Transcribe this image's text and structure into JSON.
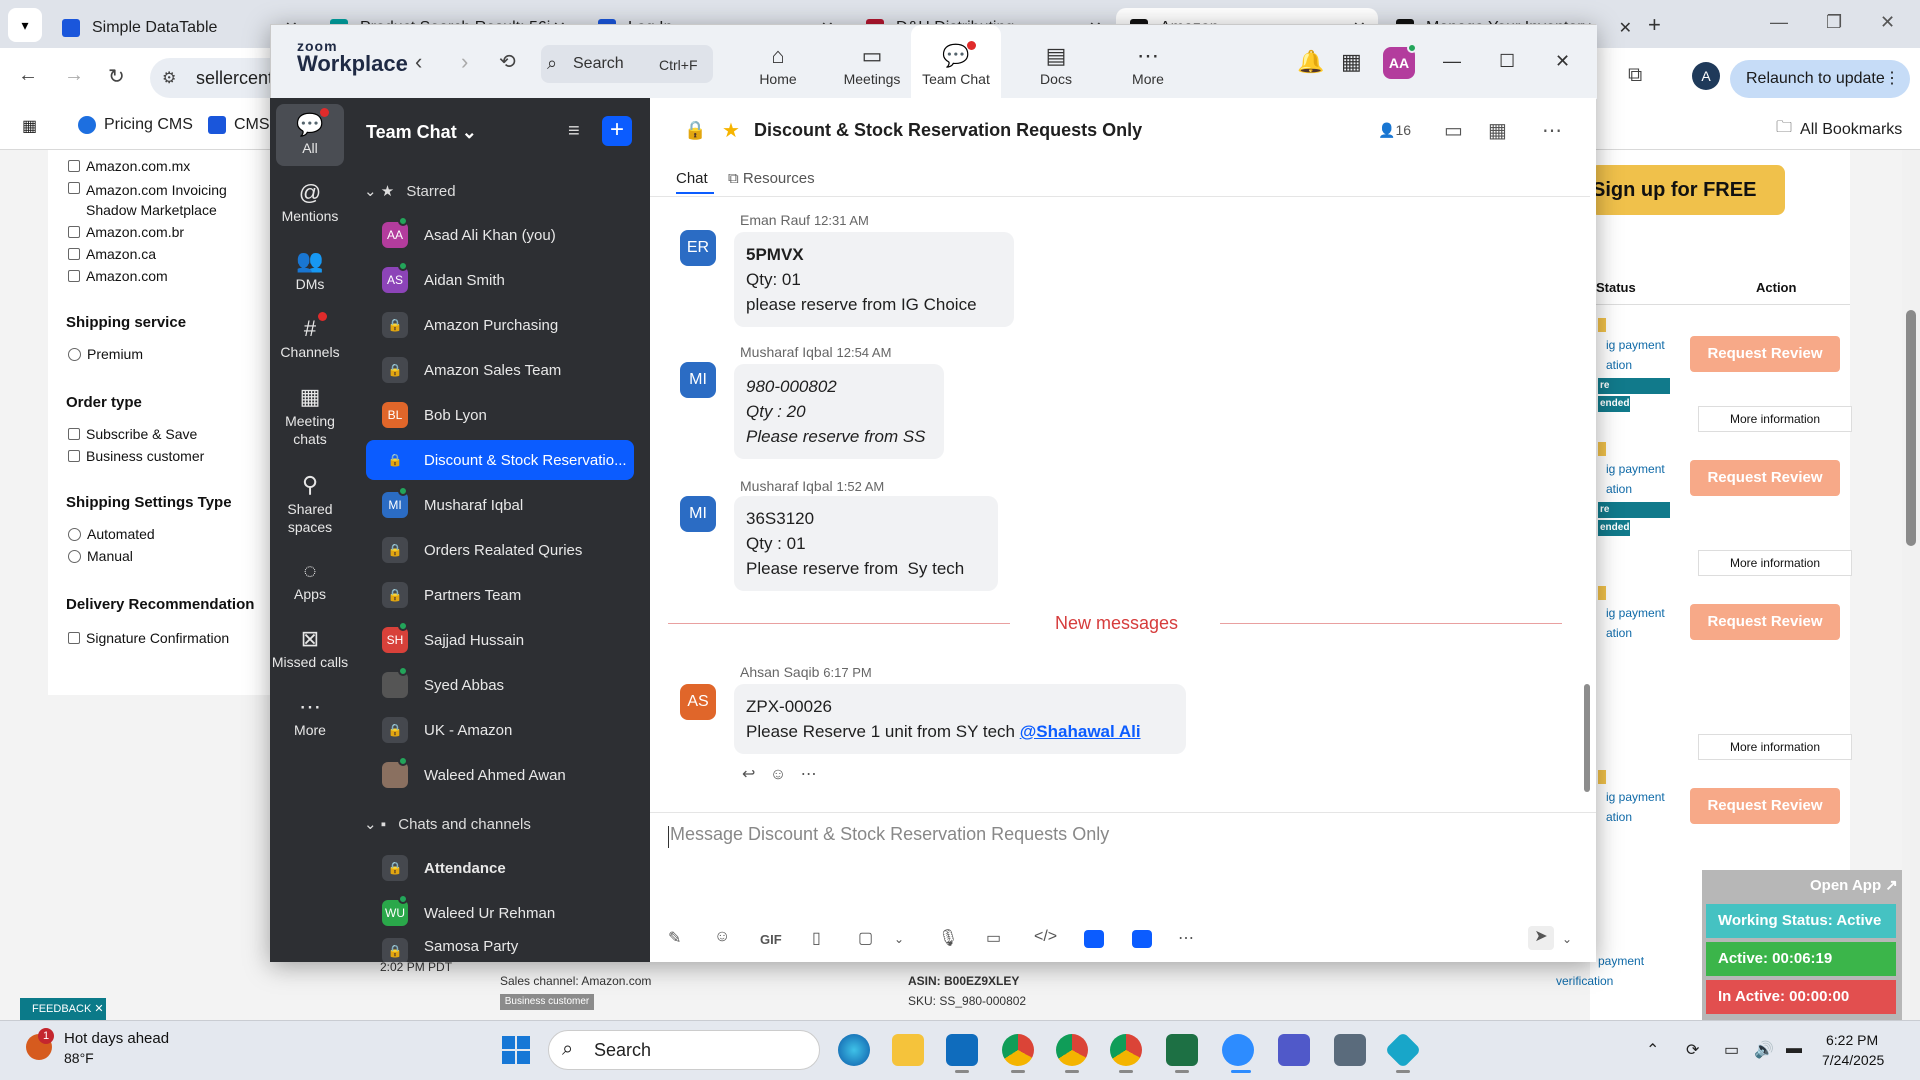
{
  "browser": {
    "tabs": [
      {
        "title": "Simple DataTable",
        "color": "#1a56db"
      },
      {
        "title": "Product Search Result: 56i",
        "color": "#00a0a0"
      },
      {
        "title": "Log In",
        "color": "#1a56db"
      },
      {
        "title": "D&H Distributing",
        "color": "#b3162f"
      },
      {
        "title": "Amazon",
        "color": "#111111"
      },
      {
        "title": "Manage Your Inventory",
        "color": "#111111"
      }
    ],
    "address": "sellercent",
    "relaunch_label": "Relaunch to update",
    "profile_letter": "A",
    "bookmarks": [
      {
        "label": "Pricing CMS",
        "color": "#1d6fe0"
      },
      {
        "label": "CMS",
        "color": "#1a56db"
      }
    ],
    "all_bookmarks_label": "All Bookmarks"
  },
  "background_page": {
    "marketplaces": [
      "Amazon.com.mx",
      "Amazon.com Invoicing Shadow Marketplace",
      "Amazon.com.br",
      "Amazon.ca",
      "Amazon.com"
    ],
    "shipping_service_heading": "Shipping service",
    "shipping_service_options": [
      "Premium"
    ],
    "order_type_heading": "Order type",
    "order_type_options": [
      "Subscribe & Save",
      "Business customer"
    ],
    "shipping_settings_heading": "Shipping Settings Type",
    "shipping_settings_options": [
      "Automated",
      "Manual"
    ],
    "delivery_heading": "Delivery Recommendation",
    "delivery_options": [
      "Signature Confirmation"
    ],
    "signup_label": "Sign up for FREE",
    "status_header": "Status",
    "action_header": "Action",
    "payment_text_a": "ig payment",
    "payment_text_b": "ation",
    "confirm_badge": "re Confirmation",
    "ended_badge": "ended",
    "request_review_label": "Request Review",
    "more_info_label": "More information",
    "bottom_time": "2:02 PM PDT",
    "sales_channel": "Sales channel: Amazon.com",
    "business_badge": "Business customer",
    "asin": "ASIN: B00EZ9XLEY",
    "sku": "SKU: SS_980-000802",
    "payment_verification_a": "payment",
    "payment_verification_b": "verification",
    "feedback_label": "FEEDBACK",
    "open_app_label": "Open App",
    "working_status": "Working Status: Active",
    "active_time": "Active: 00:06:19",
    "inactive_time": "In Active: 00:00:00"
  },
  "zoom": {
    "logo_small": "zoom",
    "logo_big": "Workplace",
    "search_placeholder": "Search",
    "search_shortcut": "Ctrl+F",
    "nav_tabs": [
      {
        "label": "Home",
        "icon": "home-icon"
      },
      {
        "label": "Meetings",
        "icon": "video-icon"
      },
      {
        "label": "Team Chat",
        "icon": "chat-icon"
      },
      {
        "label": "Docs",
        "icon": "docs-icon"
      },
      {
        "label": "More",
        "icon": "more-icon"
      }
    ],
    "avatar_initials": "AA",
    "rail": [
      {
        "label": "All",
        "icon": "chat-bubble-icon"
      },
      {
        "label": "Mentions",
        "icon": "at-icon"
      },
      {
        "label": "DMs",
        "icon": "people-icon"
      },
      {
        "label": "Channels",
        "icon": "hash-icon"
      },
      {
        "label": "Meeting chats",
        "icon": "calendar-icon"
      },
      {
        "label": "Shared spaces",
        "icon": "share-icon"
      },
      {
        "label": "Apps",
        "icon": "apps-icon"
      },
      {
        "label": "Missed calls",
        "icon": "missed-call-icon"
      },
      {
        "label": "More",
        "icon": "ellipsis-icon"
      }
    ],
    "list_title": "Team Chat",
    "starred_label": "Starred",
    "starred": [
      {
        "name": "Asad Ali Khan (you)",
        "initials": "AA",
        "color": "#b33c9d",
        "type": "user",
        "online": true
      },
      {
        "name": "Aidan Smith",
        "initials": "AS",
        "color": "#8c44b8",
        "type": "user",
        "online": true
      },
      {
        "name": "Amazon Purchasing",
        "type": "channel"
      },
      {
        "name": "Amazon Sales Team",
        "type": "channel"
      },
      {
        "name": "Bob Lyon",
        "initials": "BL",
        "color": "#e0662a",
        "type": "user",
        "online": false
      },
      {
        "name": "Discount & Stock Reservatio...",
        "type": "channel",
        "active": true
      },
      {
        "name": "Musharaf Iqbal",
        "initials": "MI",
        "color": "#2b6cc4",
        "type": "user",
        "online": true
      },
      {
        "name": "Orders Realated Quries",
        "type": "channel"
      },
      {
        "name": "Partners Team",
        "type": "channel"
      },
      {
        "name": "Sajjad Hussain",
        "initials": "SH",
        "color": "#d8413a",
        "type": "user",
        "online": true
      },
      {
        "name": "Syed Abbas",
        "initials": "SA",
        "color": "#555555",
        "type": "user",
        "online": true
      },
      {
        "name": "UK - Amazon",
        "type": "channel"
      },
      {
        "name": "Waleed Ahmed Awan",
        "initials": "WA",
        "color": "#8a7060",
        "type": "user",
        "online": true
      }
    ],
    "chats_channels_label": "Chats and channels",
    "chats_channels": [
      {
        "name": "Attendance",
        "type": "channel",
        "bold": true
      },
      {
        "name": "Waleed Ur Rehman",
        "initials": "WU",
        "color": "#2aa84a",
        "type": "user",
        "online": true
      },
      {
        "name": "Samosa Party",
        "type": "channel"
      }
    ],
    "channel_title": "Discount & Stock Reservation Requests Only",
    "member_count": "16",
    "subtabs": [
      "Chat",
      "Resources"
    ],
    "messages": [
      {
        "initials": "ER",
        "color": "#2b6cc4",
        "author": "Eman Rauf",
        "time": "12:31 AM",
        "lines": [
          "5PMVX",
          "Qty: 01",
          "please reserve from IG Choice"
        ],
        "first_bold": true,
        "italic": false
      },
      {
        "initials": "MI",
        "color": "#2b6cc4",
        "author": "Musharaf Iqbal",
        "time": "12:54 AM",
        "lines": [
          "980-000802",
          "Qty : 20",
          "Please reserve from SS"
        ],
        "first_bold": false,
        "italic": true
      },
      {
        "initials": "MI",
        "color": "#2b6cc4",
        "author": "Musharaf Iqbal",
        "time": "1:52 AM",
        "lines": [
          "36S3120",
          "Qty : 01",
          "Please reserve from  Sy tech"
        ],
        "first_bold": false,
        "italic": false
      }
    ],
    "new_messages_label": "New messages",
    "last_message": {
      "initials": "AS",
      "color": "#e0662a",
      "author": "Ahsan Saqib",
      "time": "6:17 PM",
      "line1": "ZPX-00026",
      "line2": "Please Reserve 1 unit from SY tech",
      "mention": "@Shahawal Ali"
    },
    "composer_placeholder": "Message Discount & Stock Reservation Requests Only",
    "composer_gif": "GIF"
  },
  "taskbar": {
    "weather_title": "Hot days ahead",
    "weather_temp": "88°F",
    "weather_badge": "1",
    "search_placeholder": "Search",
    "time": "6:22 PM",
    "date": "7/24/2025"
  }
}
